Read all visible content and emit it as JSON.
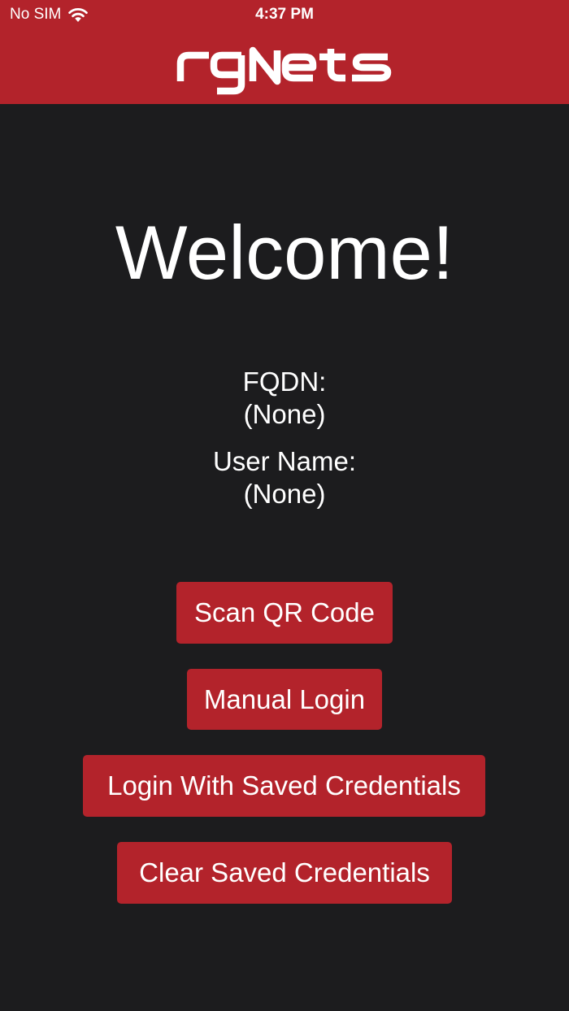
{
  "status_bar": {
    "carrier": "No SIM",
    "time": "4:37 PM",
    "wifi_icon": "wifi-icon"
  },
  "header": {
    "logo_text": "rgNets",
    "background_color": "#b3232b"
  },
  "welcome": {
    "title": "Welcome!"
  },
  "info": {
    "fqdn_label": "FQDN:",
    "fqdn_value": "(None)",
    "username_label": "User Name:",
    "username_value": "(None)"
  },
  "buttons": {
    "scan_qr": "Scan QR Code",
    "manual_login": "Manual Login",
    "login_saved": "Login With Saved Credentials",
    "clear_saved": "Clear Saved Credentials"
  },
  "colors": {
    "accent": "#b3232b",
    "background": "#1c1c1e",
    "text": "#ffffff"
  }
}
